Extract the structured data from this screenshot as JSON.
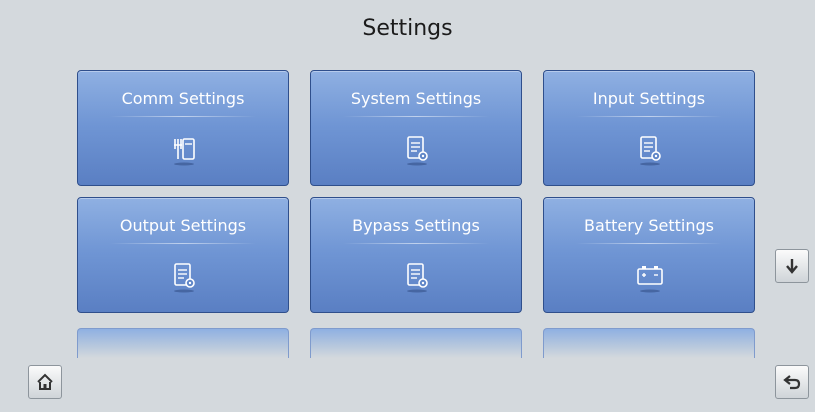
{
  "header": {
    "title": "Settings"
  },
  "tiles": [
    {
      "label": "Comm Settings",
      "icon": "comm-port-icon"
    },
    {
      "label": "System Settings",
      "icon": "settings-document-icon"
    },
    {
      "label": "Input Settings",
      "icon": "settings-document-icon"
    },
    {
      "label": "Output Settings",
      "icon": "settings-document-icon"
    },
    {
      "label": "Bypass Settings",
      "icon": "settings-document-icon"
    },
    {
      "label": "Battery Settings",
      "icon": "battery-icon"
    }
  ],
  "nav": {
    "home_icon": "home-icon",
    "scroll_down_icon": "arrow-down-icon",
    "back_icon": "back-arrow-icon"
  },
  "colors": {
    "tile_top": "#8fb0e2",
    "tile_bottom": "#5a7fc3",
    "background": "#d4d9dd"
  }
}
